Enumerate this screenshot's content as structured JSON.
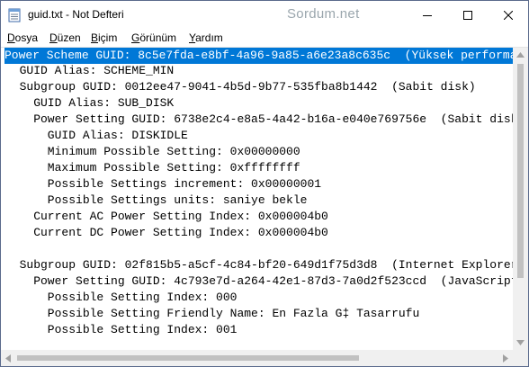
{
  "window": {
    "title": "guid.txt - Not Defteri",
    "watermark": "Sordum.net",
    "icon": "notepad-icon"
  },
  "controls": {
    "minimize_icon": "minimize-icon",
    "maximize_icon": "maximize-icon",
    "close_icon": "close-icon"
  },
  "menu": [
    {
      "first": "D",
      "rest": "osya"
    },
    {
      "first": "D",
      "rest": "üzen"
    },
    {
      "first": "B",
      "rest": "içim"
    },
    {
      "first": "G",
      "rest": "örünüm"
    },
    {
      "first": "Y",
      "rest": "ardım"
    }
  ],
  "editor": {
    "lines": [
      "Power Scheme GUID: 8c5e7fda-e8bf-4a96-9a85-a6e23a8c635c  (Yüksek performans)",
      "  GUID Alias: SCHEME_MIN",
      "  Subgroup GUID: 0012ee47-9041-4b5d-9b77-535fba8b1442  (Sabit disk)",
      "    GUID Alias: SUB_DISK",
      "    Power Setting GUID: 6738e2c4-e8a5-4a42-b16a-e040e769756e  (Sabit diskin kapatılması)",
      "      GUID Alias: DISKIDLE",
      "      Minimum Possible Setting: 0x00000000",
      "      Maximum Possible Setting: 0xffffffff",
      "      Possible Settings increment: 0x00000001",
      "      Possible Settings units: saniye bekle",
      "    Current AC Power Setting Index: 0x000004b0",
      "    Current DC Power Setting Index: 0x000004b0",
      "",
      "  Subgroup GUID: 02f815b5-a5cf-4c84-bf20-649d1f75d3d8  (Internet Explorer)",
      "    Power Setting GUID: 4c793e7d-a264-42e1-87d3-7a0d2f523ccd  (JavaScript Zamanlayıcısı Sıklığı)",
      "      Possible Setting Index: 000",
      "      Possible Setting Friendly Name: En Fazla G‡ Tasarrufu",
      "      Possible Setting Index: 001"
    ]
  }
}
